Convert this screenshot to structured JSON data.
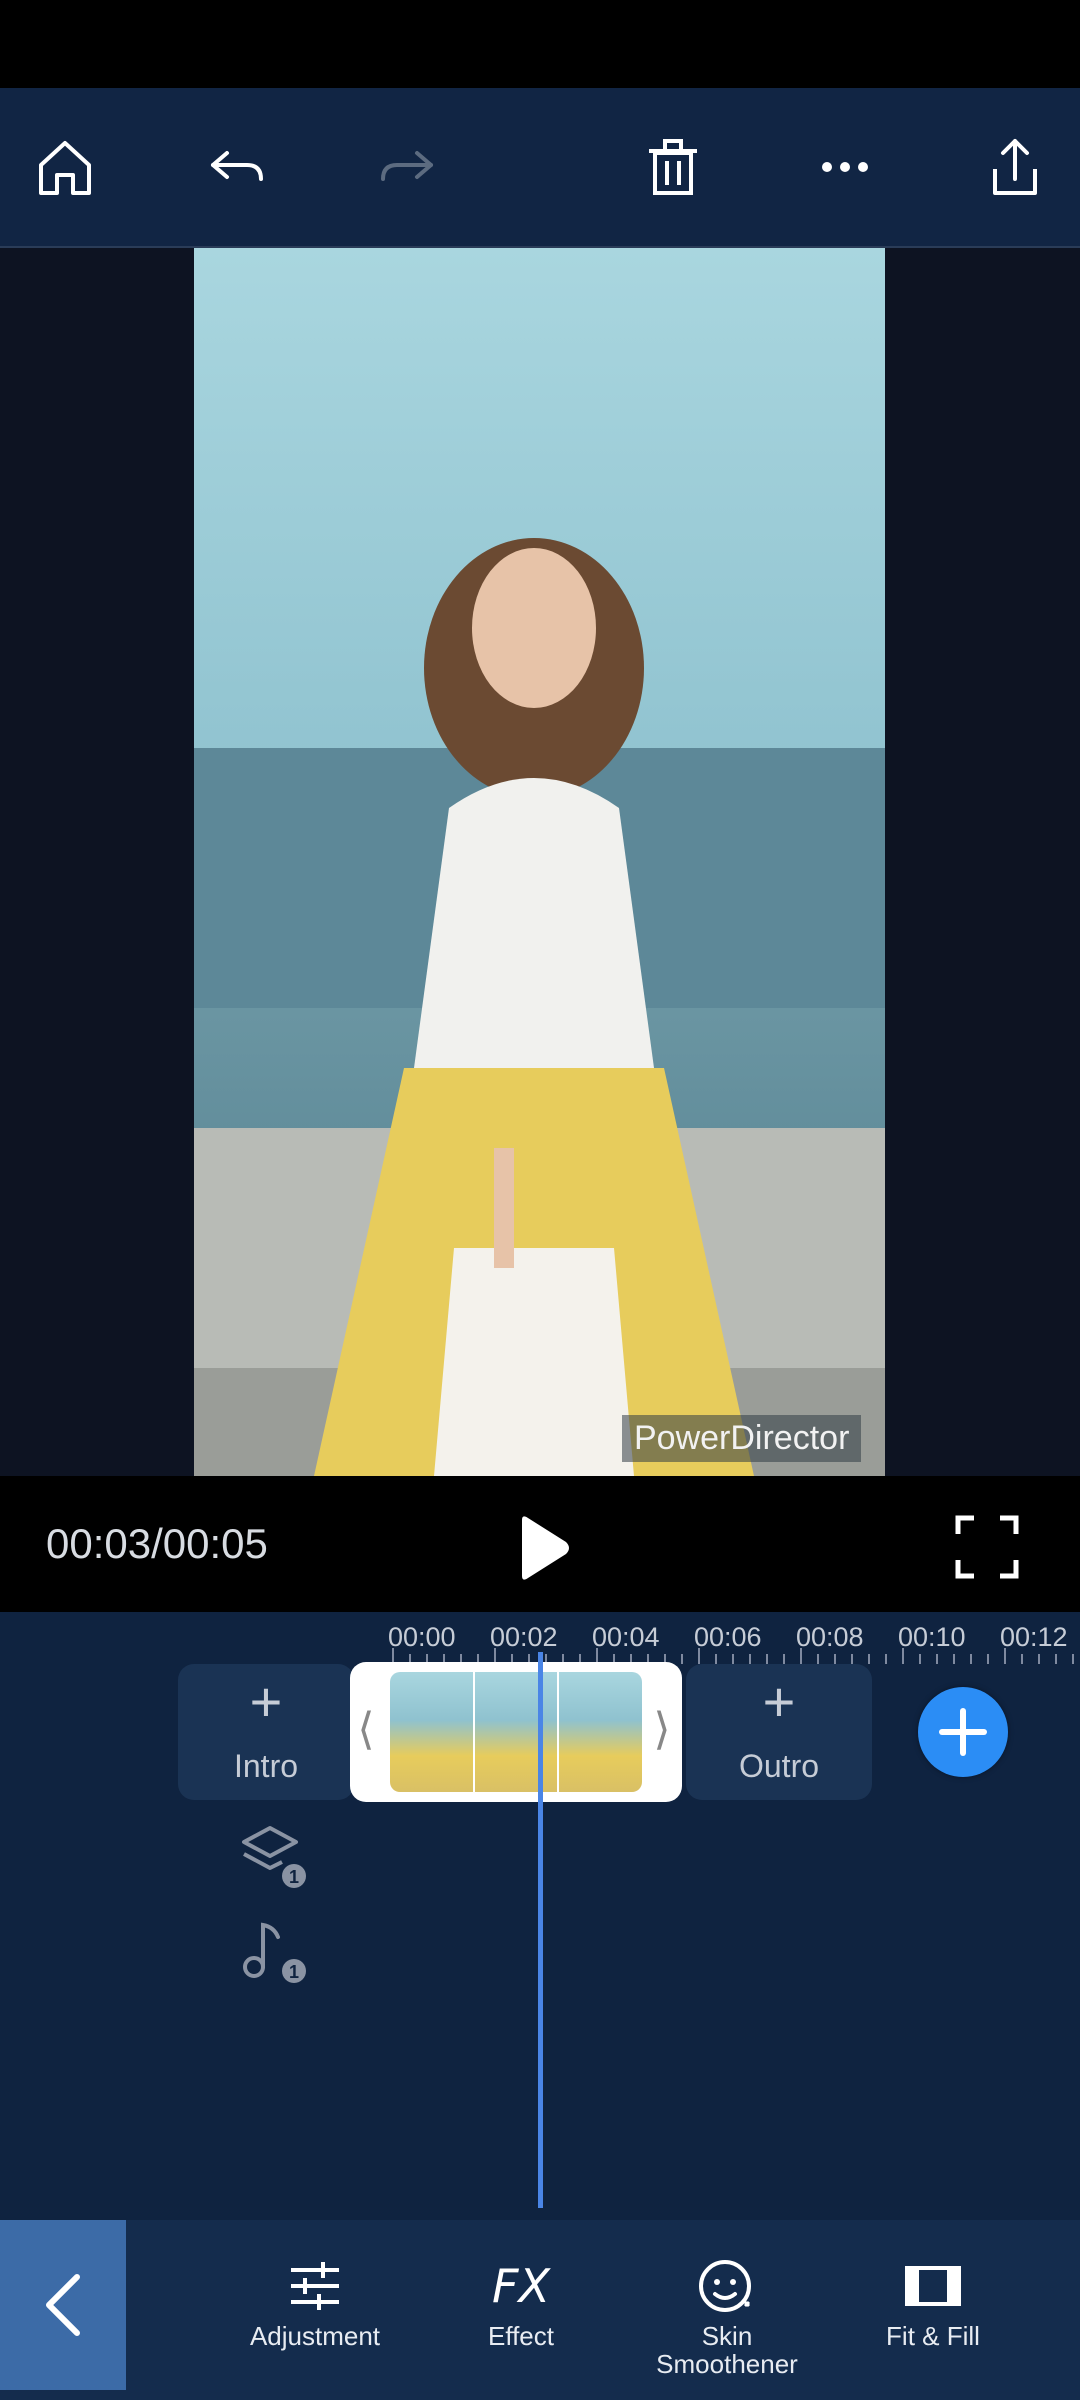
{
  "toolbar": {
    "home": "home-icon",
    "undo": "undo-icon",
    "redo": "redo-icon",
    "delete": "trash-icon",
    "more": "more-icon",
    "export": "share-icon"
  },
  "preview": {
    "watermark": "PowerDirector"
  },
  "playback": {
    "time": "00:03/00:05"
  },
  "timeline": {
    "ticks": [
      "00:00",
      "00:02",
      "00:04",
      "00:06",
      "00:08",
      "00:10",
      "00:12"
    ],
    "intro_label": "Intro",
    "outro_label": "Outro",
    "layer_count": "1",
    "music_count": "1"
  },
  "tools": {
    "adjustment": "Adjustment",
    "effect_icon": "FX",
    "effect": "Effect",
    "skin_smoothener": "Skin\nSmoothener",
    "fit_fill": "Fit & Fill"
  },
  "colors": {
    "accent": "#2b8df5",
    "playhead": "#4a85e6",
    "toolbar_bg": "#112544",
    "timeline_bg": "#0f2340"
  }
}
